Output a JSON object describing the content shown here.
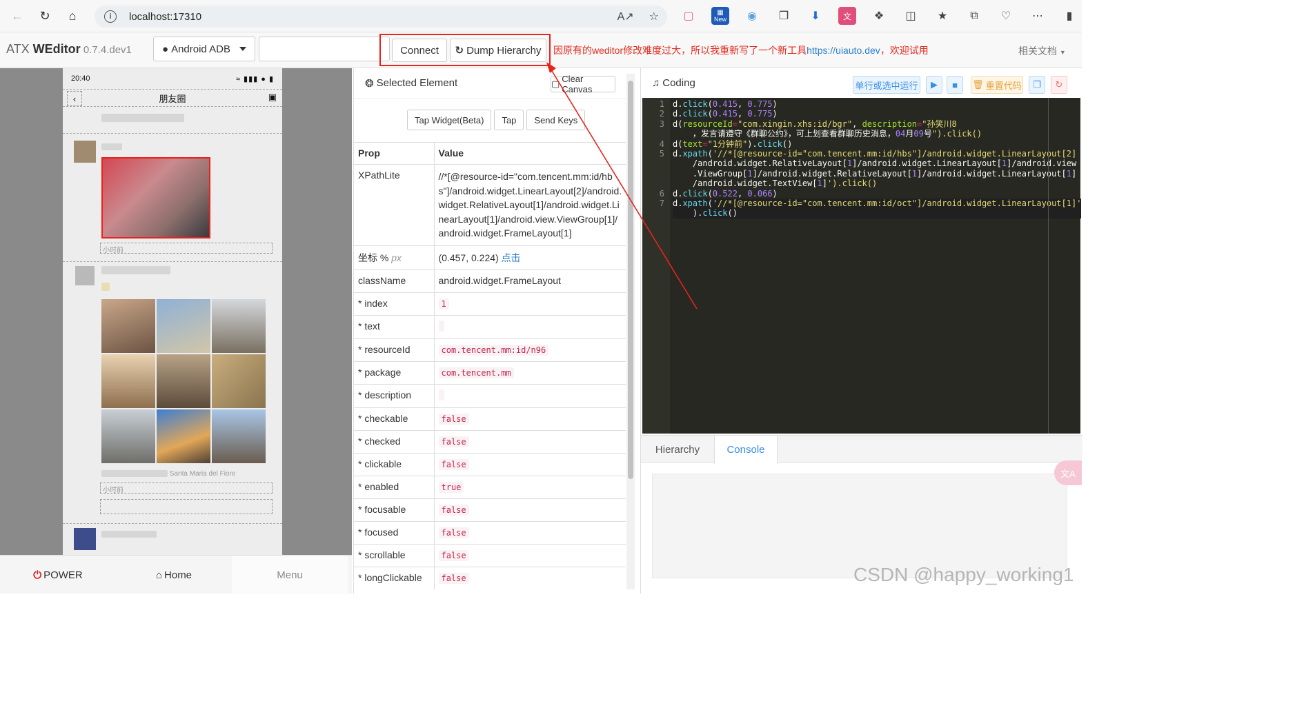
{
  "browser": {
    "url": "localhost:17310",
    "ext_new_badge": "New"
  },
  "header": {
    "brand_prefix": "ATX ",
    "brand_name": "WEditor",
    "version": " 0.7.4.dev1",
    "platform": "Android ADB",
    "serial_value": "",
    "connect_label": "Connect",
    "dump_label": "Dump Hierarchy",
    "notice_text": "因原有的weditor修改难度过大，所以我重新写了一个新工具",
    "notice_link": "https://uiauto.dev",
    "notice_tail": "，欢迎试用",
    "docs_label": "相关文档"
  },
  "device": {
    "status_time": "20:40",
    "page_title": "朋友圈",
    "power_label": "POWER",
    "home_label": "Home",
    "menu_label": "Menu",
    "time_label_1": "小时前",
    "time_label_2": "小时前",
    "caption_tail": "Santa Maria del Fiore"
  },
  "props": {
    "title": "Selected Element",
    "clear_canvas": "Clear Canvas",
    "tap_widget": "Tap Widget(Beta)",
    "tap": "Tap",
    "send_keys": "Send Keys",
    "col_prop": "Prop",
    "col_value": "Value",
    "xpath_label": "XPathLite",
    "xpath_value": "//*[@resource-id=\"com.tencent.mm:id/hbs\"]/android.widget.LinearLayout[2]/android.widget.RelativeLayout[1]/android.widget.LinearLayout[1]/android.view.ViewGroup[1]/android.widget.FrameLayout[1]",
    "coord_label": "坐标 %",
    "coord_px": "px",
    "coord_value": "(0.457, 0.224)",
    "coord_link": "点击",
    "class_label": "className",
    "class_value": "android.widget.FrameLayout",
    "rows": [
      {
        "key": "* index",
        "value": "1"
      },
      {
        "key": "* text",
        "value": ""
      },
      {
        "key": "* resourceId",
        "value": "com.tencent.mm:id/n96"
      },
      {
        "key": "* package",
        "value": "com.tencent.mm"
      },
      {
        "key": "* description",
        "value": ""
      },
      {
        "key": "* checkable",
        "value": "false"
      },
      {
        "key": "* checked",
        "value": "false"
      },
      {
        "key": "* clickable",
        "value": "false"
      },
      {
        "key": "* enabled",
        "value": "true"
      },
      {
        "key": "* focusable",
        "value": "false"
      },
      {
        "key": "* focused",
        "value": "false"
      },
      {
        "key": "* scrollable",
        "value": "false"
      },
      {
        "key": "* longClickable",
        "value": "false"
      }
    ]
  },
  "coding": {
    "title": "Coding",
    "run_line": "单行或选中运行",
    "reset_code": "重置代码",
    "tab_hierarchy": "Hierarchy",
    "tab_console": "Console",
    "line_numbers": [
      "1",
      "2",
      "3",
      "",
      "4",
      "5",
      "",
      "",
      "",
      "6",
      "7",
      ""
    ],
    "code_lines": [
      "d.click(0.415, 0.775)",
      "d.click(0.415, 0.775)",
      "d(resourceId=\"com.xingin.xhs:id/bgr\", description=\"孙笑川8",
      "    ，发言请遵守《群聊公约》，可上划查看群聊历史消息，04月09号\").click()",
      "d(text=\"1分钟前\").click()",
      "d.xpath('//*[@resource-id=\"com.tencent.mm:id/hbs\"]/android.widget.LinearLayout[2]",
      "    /android.widget.RelativeLayout[1]/android.widget.LinearLayout[1]/android.view",
      "    .ViewGroup[1]/android.widget.RelativeLayout[1]/android.widget.LinearLayout[1]",
      "    /android.widget.TextView[1]').click()",
      "d.click(0.522, 0.066)",
      "d.xpath('//*[@resource-id=\"com.tencent.mm:id/oct\"]/android.widget.LinearLayout[1]'",
      "    ).click()"
    ]
  },
  "watermark": "CSDN @happy_working1",
  "colors": {
    "annotation_red": "#e8231b",
    "link_blue": "#2a7ec9",
    "editor_bg": "#272822"
  }
}
